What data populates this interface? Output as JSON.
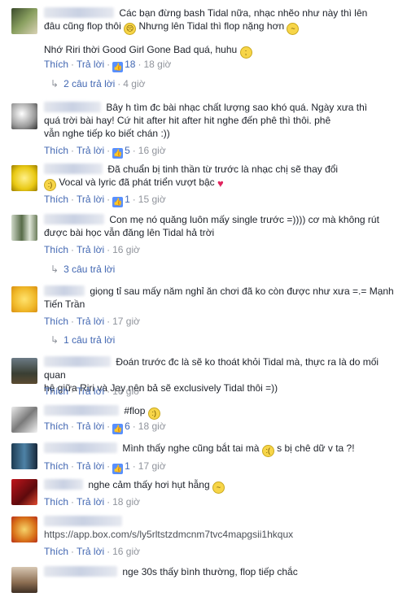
{
  "actions": {
    "like": "Thích",
    "reply": "Trả lời",
    "sep": "·"
  },
  "comments": [
    {
      "text": "Các bạn đừng bash Tidal nữa, nhạc nhẽo như này thì lên",
      "line2": "đâu cũng flop thôi",
      "line2b": "Nhưng lên Tidal thì flop nặng hơn",
      "line3": "Nhớ Riri thời Good Girl Gone Bad quá, huhu",
      "likes": "18",
      "time": "18 giờ",
      "replies": "2 câu trả lời",
      "replies_time": "4 giờ"
    },
    {
      "text": "Bây h tìm đc bài nhạc chất lượng sao khó quá. Ngày xưa thì",
      "line2": "quá trời bài hay! Cứ hit after hit after hit nghe đến phê thì thôi. phê",
      "line3": "vẫn nghe tiếp ko biết chán :))",
      "likes": "5",
      "time": "16 giờ"
    },
    {
      "text": "Đã chuẩn bị tinh thần từ trước là nhạc chị sẽ thay đổi",
      "line2": "Vocal và lyric đã phát triển vượt bậc",
      "likes": "1",
      "time": "15 giờ"
    },
    {
      "text": "Con mẹ nó quăng luôn mấy single trước =)))) cơ mà không rút",
      "line2": "được bài học vẫn đăng lên Tidal hả trời",
      "time": "16 giờ",
      "replies": "3 câu trả lời"
    },
    {
      "text": "giọng tỉ sau mấy năm nghỉ ăn chơi đã ko còn được như xưa =.= Mạnh",
      "line2": "Tiến Trần",
      "time": "17 giờ",
      "replies": "1 câu trả lời"
    },
    {
      "text": "Đoán trước đc là sẽ ko thoát khỏi Tidal mà, thực ra là do mối quan",
      "line2": "hệ giữa Riri và Jay nên bả sẽ exclusively Tidal thôi =))",
      "time": "16 giờ"
    },
    {
      "text": "#flop",
      "likes": "6",
      "time": "18 giờ"
    },
    {
      "text": "Mình thấy nghe cũng bắt tai mà",
      "textb": "s bị chê dữ v ta ?!",
      "likes": "1",
      "time": "17 giờ"
    },
    {
      "text": "nghe cảm thấy hơi hụt hẫng",
      "time": "18 giờ"
    },
    {
      "link": "https://app.box.com/s/ly5rltstzdmcnm7tvc4mapgsii1hkqux",
      "time": "16 giờ"
    },
    {
      "text": "nge 30s thấy bình thường, flop tiếp chắc"
    }
  ]
}
